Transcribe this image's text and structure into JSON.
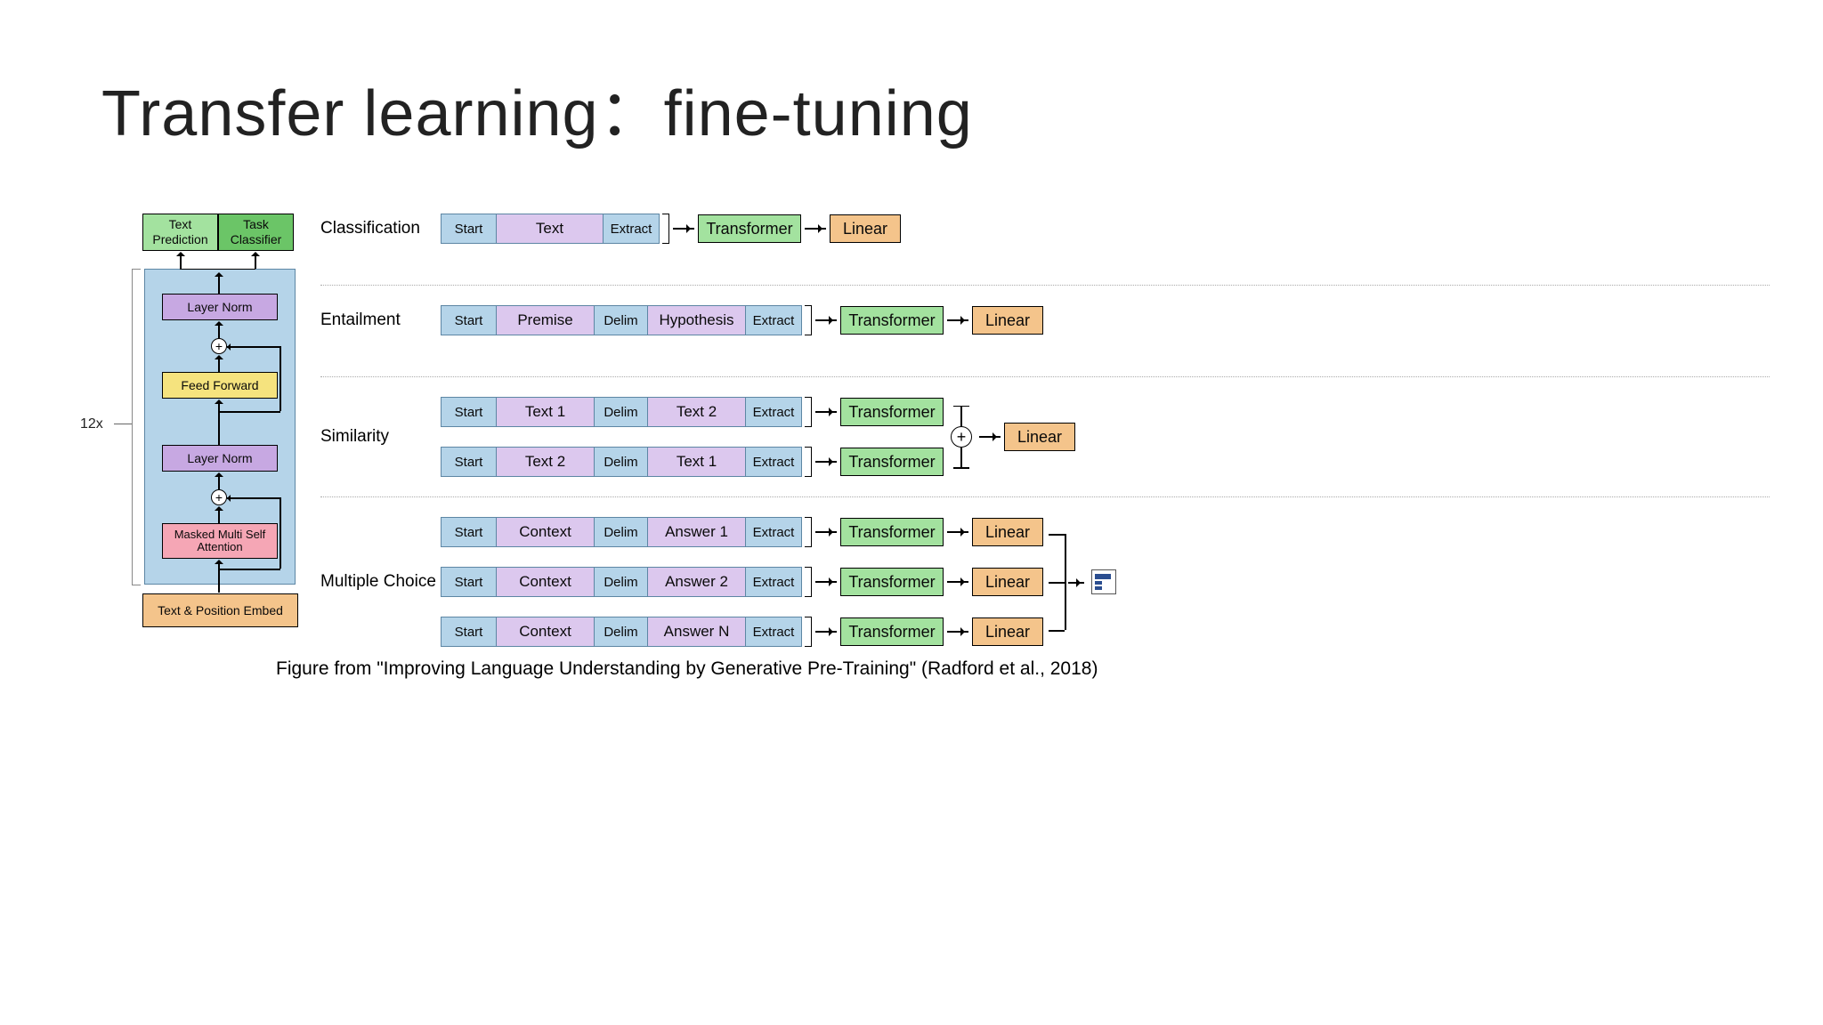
{
  "title": "Transfer learning：fine-tuning",
  "arch": {
    "repeat_label": "12x",
    "heads": {
      "text_prediction": "Text\nPrediction",
      "task_classifier": "Task\nClassifier"
    },
    "layer_norm": "Layer Norm",
    "feed_forward": "Feed Forward",
    "masked_multi": "Masked Multi\nSelf Attention",
    "embed": "Text & Position Embed",
    "plus": "+"
  },
  "tasks": {
    "classification": {
      "label": "Classification",
      "seq": [
        "Start",
        "Text",
        "Extract"
      ],
      "transformer": "Transformer",
      "linear": "Linear"
    },
    "entailment": {
      "label": "Entailment",
      "seq": [
        "Start",
        "Premise",
        "Delim",
        "Hypothesis",
        "Extract"
      ],
      "transformer": "Transformer",
      "linear": "Linear"
    },
    "similarity": {
      "label": "Similarity",
      "rows": [
        [
          "Start",
          "Text 1",
          "Delim",
          "Text 2",
          "Extract"
        ],
        [
          "Start",
          "Text 2",
          "Delim",
          "Text 1",
          "Extract"
        ]
      ],
      "transformer": "Transformer",
      "linear": "Linear",
      "plus": "+"
    },
    "multiple_choice": {
      "label": "Multiple Choice",
      "rows": [
        [
          "Start",
          "Context",
          "Delim",
          "Answer 1",
          "Extract"
        ],
        [
          "Start",
          "Context",
          "Delim",
          "Answer 2",
          "Extract"
        ],
        [
          "Start",
          "Context",
          "Delim",
          "Answer N",
          "Extract"
        ]
      ],
      "transformer": "Transformer",
      "linear": "Linear"
    }
  },
  "caption": {
    "prefix": "Figure from \"",
    "title": "Improving Language Understanding by Generative Pre-Training",
    "suffix": "\" (Radford et al., 2018)"
  }
}
